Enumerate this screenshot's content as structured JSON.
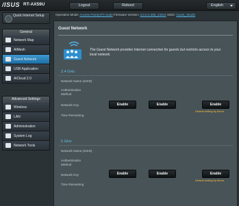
{
  "header": {
    "logo": "/ISUS",
    "model": "RT-AX59U",
    "logout_label": "Logout",
    "reboot_label": "Reboot",
    "language": "English"
  },
  "status": {
    "mode_label": "Operation Mode:",
    "mode_value": "Access Point(AP) mode",
    "firmware_label": "Firmware Version:",
    "firmware_value": "3.0.0.4.388_23344",
    "ssid_label": "SSID:",
    "ssid_value": "Guest_Studio"
  },
  "sidebar": {
    "qis_label": "Quick Internet Setup",
    "general_header": "General",
    "general_items": [
      {
        "label": "Network Map"
      },
      {
        "label": "AiMesh"
      },
      {
        "label": "Guest Network"
      },
      {
        "label": "USB Application"
      },
      {
        "label": "AiCloud 2.0"
      }
    ],
    "advanced_header": "Advanced Settings",
    "advanced_items": [
      {
        "label": "Wireless"
      },
      {
        "label": "LAN"
      },
      {
        "label": "Administration"
      },
      {
        "label": "System Log"
      },
      {
        "label": "Network Tools"
      }
    ]
  },
  "main": {
    "title": "Guest Network",
    "description": "The Guest Network provides Internet connection for guests but restricts access to your local network.",
    "bands": [
      {
        "name": "2.4 GHz",
        "rows": [
          "Network Name (SSID)",
          "Authentication Method",
          "Network Key",
          "Time Remaining"
        ],
        "buttons": [
          "Enable",
          "Enable",
          "Enable"
        ],
        "alexa_note": "Default setting by Alexa"
      },
      {
        "name": "5 GHz",
        "rows": [
          "Network Name (SSID)",
          "Authentication Method",
          "Network Key",
          "Time Remaining"
        ],
        "buttons": [
          "Enable",
          "Enable",
          "Enable"
        ],
        "alexa_note": "Default setting by Alexa"
      }
    ]
  },
  "colors": {
    "accent": "#3d98d0",
    "link": "#58b9ec",
    "band_title": "#64bde8",
    "alexa_note": "#ffbf3c",
    "panel_bg": "#485357",
    "page_bg": "#2b3236"
  },
  "icons": [
    "qis-icon",
    "network-map-icon",
    "aimesh-icon",
    "guest-network-icon",
    "usb-icon",
    "aicloud-icon",
    "wireless-icon",
    "lan-icon",
    "administration-icon",
    "system-log-icon",
    "network-tools-icon"
  ]
}
